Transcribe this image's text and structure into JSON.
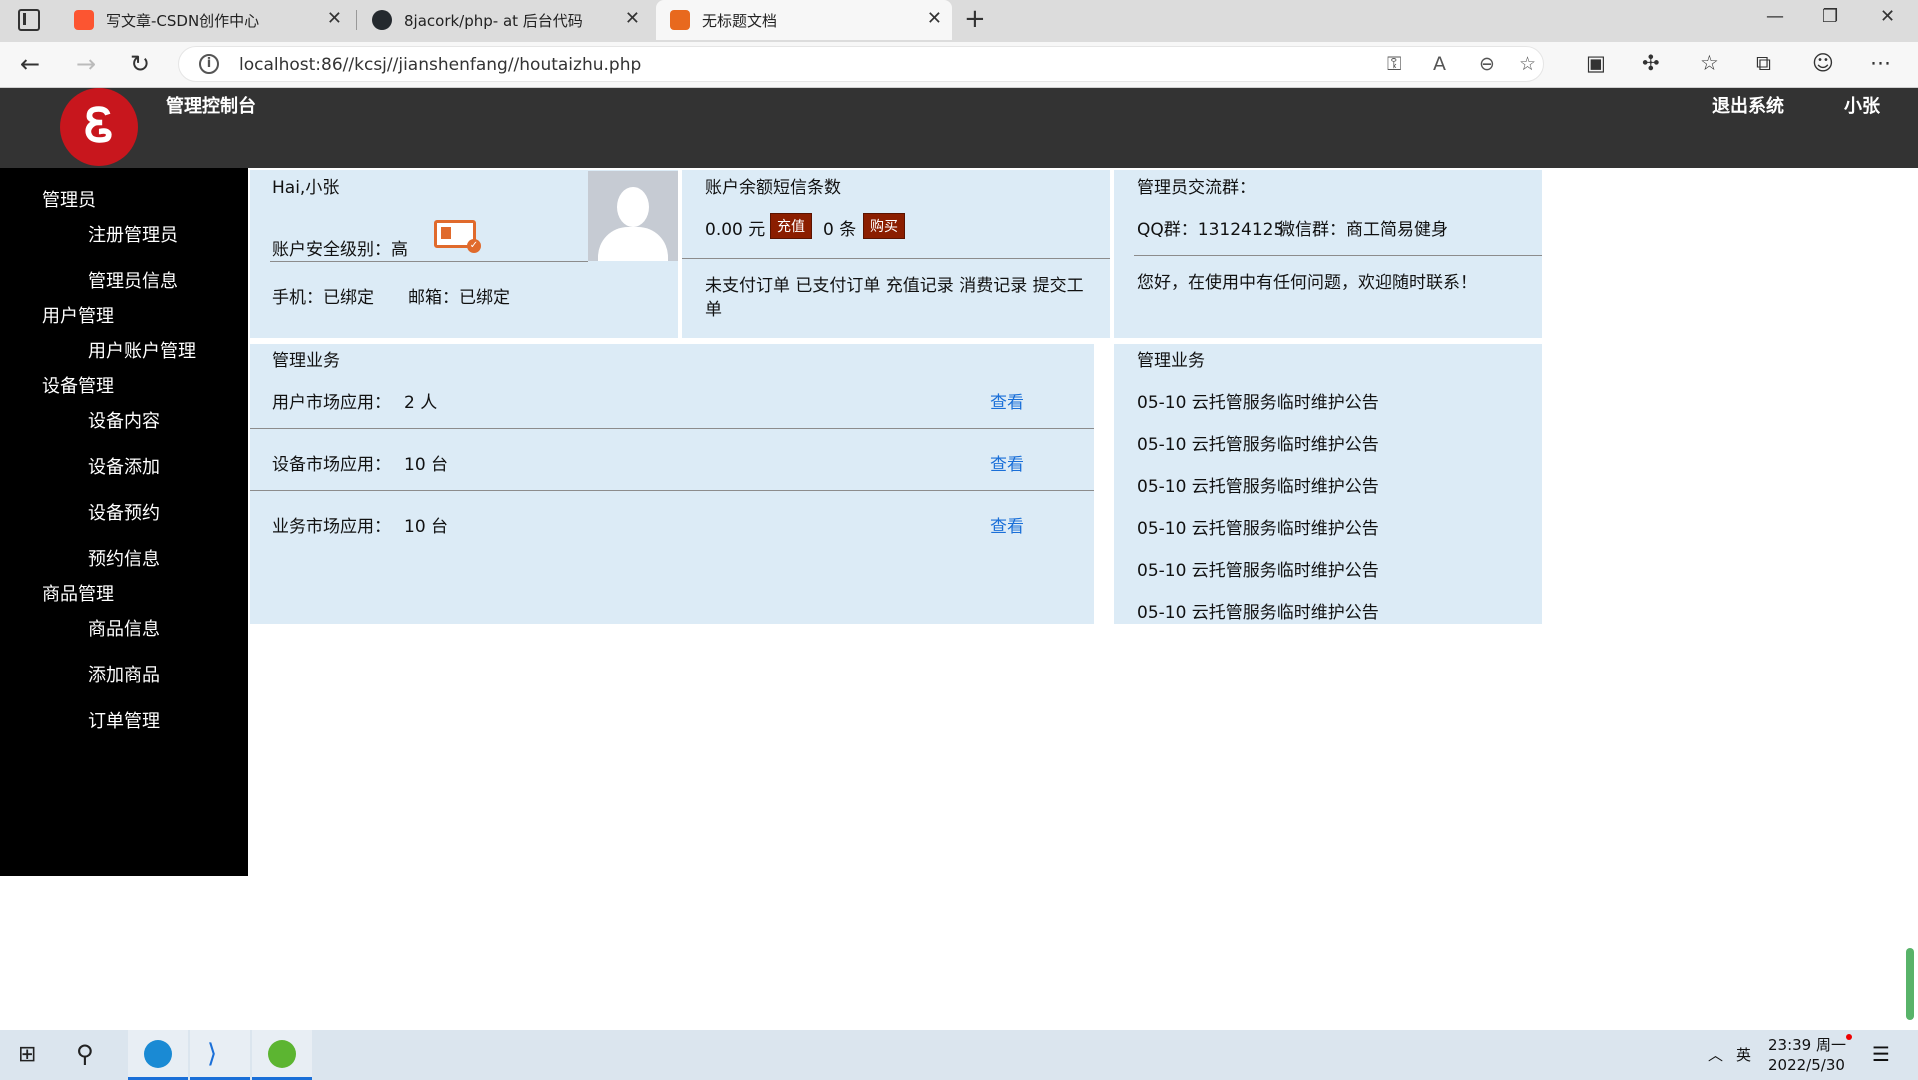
{
  "browser": {
    "tabs": [
      {
        "title": "写文章-CSDN创作中心",
        "favicon": "csdn-icon",
        "color": "#fc5531"
      },
      {
        "title": "8jacork/php- at 后台代码",
        "favicon": "github-icon",
        "color": "#24292e"
      },
      {
        "title": "无标题文档",
        "favicon": "page-icon",
        "color": "#e8691e"
      }
    ],
    "url": "localhost:86//kcsj//jianshenfang//houtaizhu.php"
  },
  "header": {
    "console_title": "管理控制台",
    "logout": "退出系统",
    "username": "小张"
  },
  "sidebar": {
    "groups": [
      {
        "label": "管理员",
        "items": [
          "注册管理员",
          "管理员信息"
        ]
      },
      {
        "label": "用户管理",
        "items": [
          "用户账户管理"
        ]
      },
      {
        "label": "设备管理",
        "items": [
          "设备内容",
          "设备添加",
          "设备预约",
          "预约信息"
        ]
      },
      {
        "label": "商品管理",
        "items": [
          "商品信息",
          "添加商品",
          "订单管理"
        ]
      }
    ]
  },
  "account": {
    "greeting": "Hai,小张",
    "security_label": "账户安全级别：高",
    "phone": "手机：已绑定",
    "email": "邮箱：已绑定"
  },
  "balance": {
    "title": "账户余额短信条数",
    "amount": "0.00 元",
    "recharge_btn": "充值",
    "sms_count": "0 条",
    "buy_btn": "购买",
    "links": "未支付订单 已支付订单 充值记录 消费记录 提交工",
    "links_wrap": "单"
  },
  "group_chat": {
    "title": "管理员交流群：",
    "qq": "QQ群：13124125",
    "wechat": "微信群：商工简易健身",
    "message": "您好，在使用中有任何问题，欢迎随时联系！"
  },
  "business": {
    "title": "管理业务",
    "rows": [
      {
        "label": "用户市场应用：",
        "value": "2 人",
        "action": "查看"
      },
      {
        "label": "设备市场应用：",
        "value": "10 台",
        "action": "查看"
      },
      {
        "label": "业务市场应用：",
        "value": "10 台",
        "action": "查看"
      }
    ]
  },
  "notices": {
    "title": "管理业务",
    "items": [
      "05-10 云托管服务临时维护公告",
      "05-10 云托管服务临时维护公告",
      "05-10 云托管服务临时维护公告",
      "05-10 云托管服务临时维护公告",
      "05-10 云托管服务临时维护公告",
      "05-10 云托管服务临时维护公告"
    ]
  },
  "taskbar": {
    "ime": "英",
    "time": "23:39 周一",
    "date": "2022/5/30"
  },
  "colors": {
    "header_bg": "#333333",
    "sidebar_bg": "#000000",
    "panel_bg": "#dcebf6",
    "logo_red": "#c8161d",
    "button_dark": "#8b1e00",
    "link_blue": "#1a6fd8"
  }
}
